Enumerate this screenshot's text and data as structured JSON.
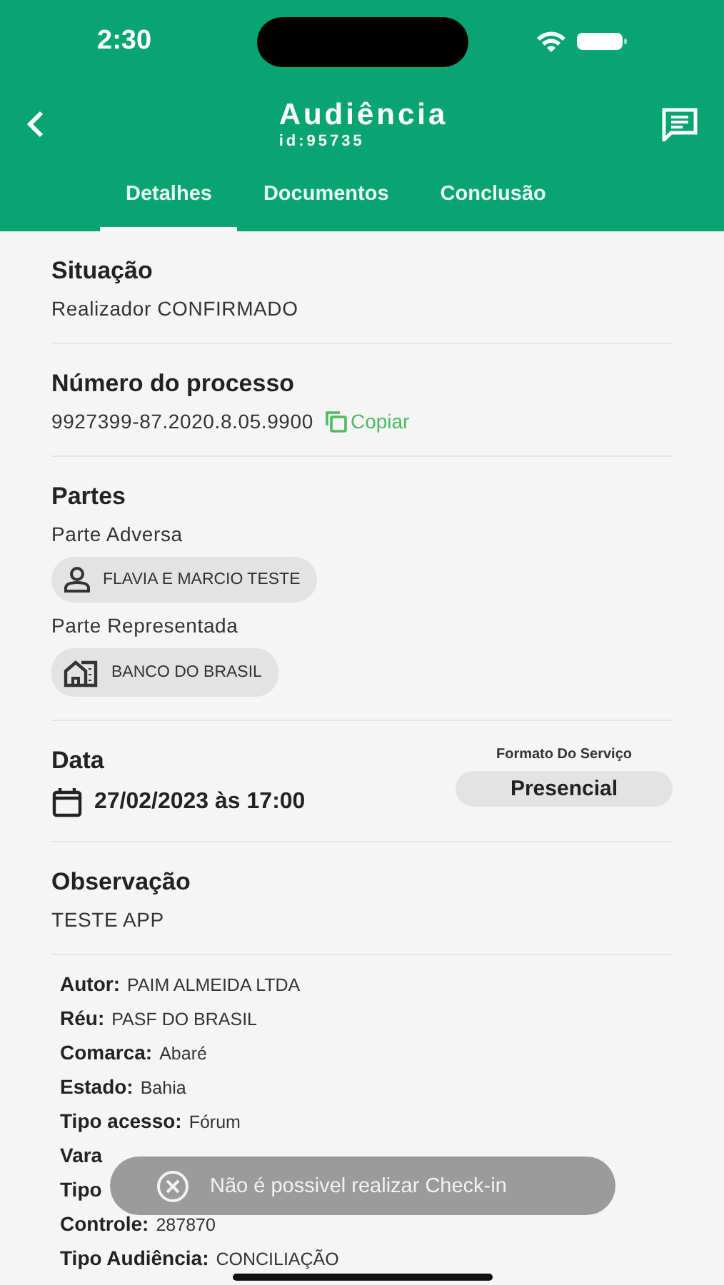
{
  "status_bar": {
    "time": "2:30"
  },
  "header": {
    "title": "Audiência",
    "subtitle": "id:95735"
  },
  "tabs": [
    {
      "label": "Detalhes",
      "selected": true
    },
    {
      "label": "Documentos",
      "selected": false
    },
    {
      "label": "Conclusão",
      "selected": false
    }
  ],
  "situacao": {
    "heading": "Situação",
    "value": "Realizador CONFIRMADO"
  },
  "processo": {
    "heading": "Número do processo",
    "value": "9927399-87.2020.8.05.9900",
    "copy_label": "Copiar"
  },
  "partes": {
    "heading": "Partes",
    "groups": [
      {
        "label": "Parte Adversa",
        "chip": "FLAVIA E MARCIO TESTE",
        "kind": "person"
      },
      {
        "label": "Parte Representada",
        "chip": "BANCO DO BRASIL",
        "kind": "company"
      }
    ]
  },
  "data": {
    "heading": "Data",
    "value": "27/02/2023 às 17:00",
    "format_label": "Formato Do Serviço",
    "format_value": "Presencial"
  },
  "observacao": {
    "heading": "Observação",
    "value": "TESTE APP"
  },
  "details": [
    {
      "label": "Autor:",
      "value": "PAIM ALMEIDA LTDA"
    },
    {
      "label": "Réu:",
      "value": "PASF DO BRASIL"
    },
    {
      "label": "Comarca:",
      "value": "Abaré"
    },
    {
      "label": "Estado:",
      "value": "Bahia"
    },
    {
      "label": "Tipo acesso:",
      "value": "Fórum"
    },
    {
      "label": "Vara"
    },
    {
      "label": "Tipo"
    },
    {
      "label": "Controle:",
      "value": "287870"
    },
    {
      "label": "Tipo Audiência:",
      "value": "CONCILIAÇÃO"
    }
  ],
  "toast": {
    "message": "Não é possivel realizar Check-in"
  }
}
